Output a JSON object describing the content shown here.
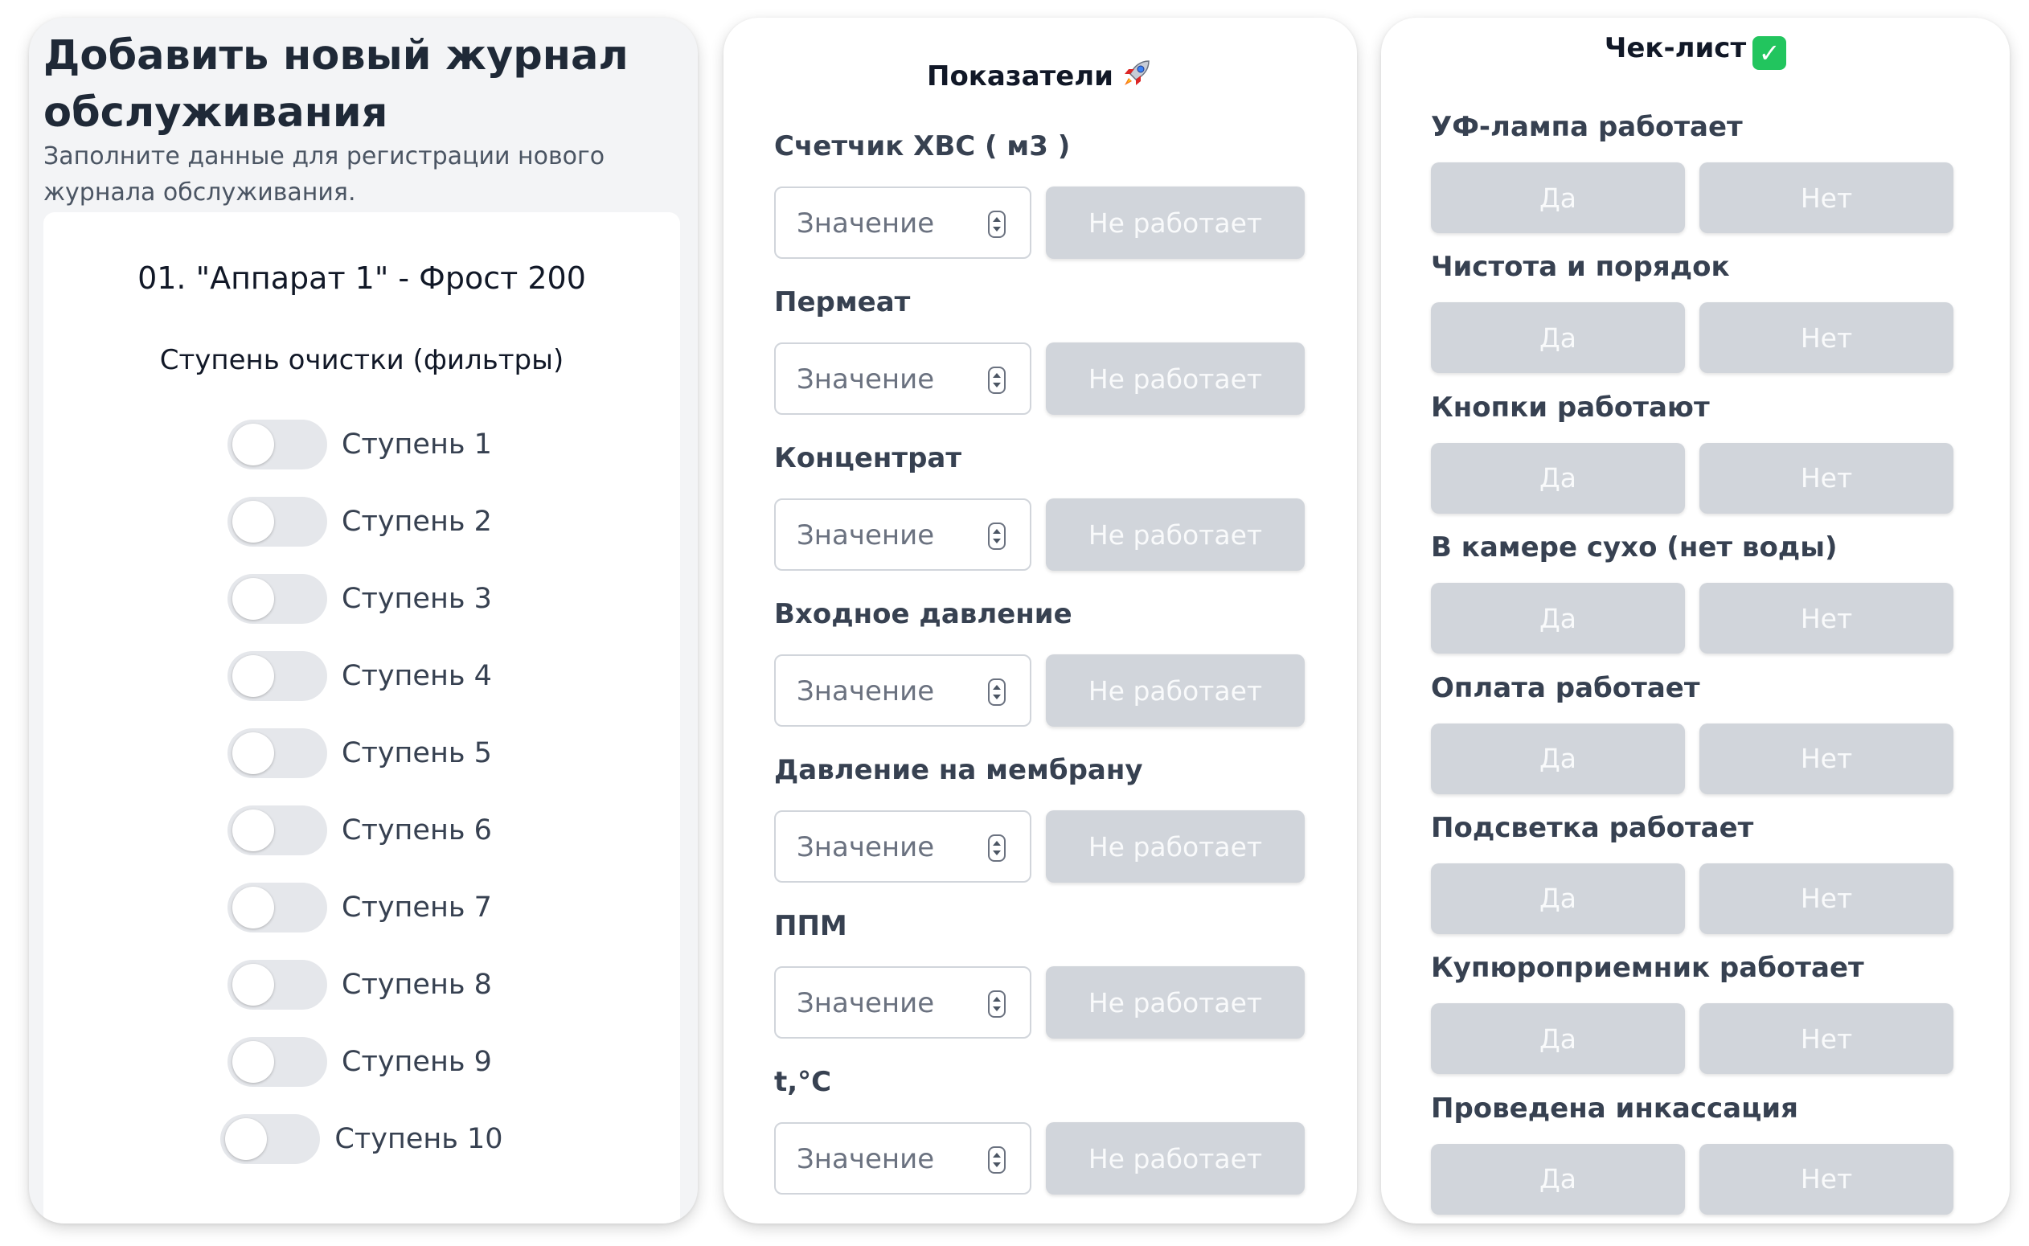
{
  "left": {
    "title": "Добавить новый журнал обслуживания",
    "subtitle": "Заполните данные для регистрации нового журнала обслуживания.",
    "device_name": "01. \"Аппарат 1\" - Фрост 200",
    "stages_heading": "Ступень очистки (фильтры)",
    "stages": [
      {
        "label": "Ступень 1",
        "on": false
      },
      {
        "label": "Ступень 2",
        "on": false
      },
      {
        "label": "Ступень 3",
        "on": false
      },
      {
        "label": "Ступень 4",
        "on": false
      },
      {
        "label": "Ступень 5",
        "on": false
      },
      {
        "label": "Ступень 6",
        "on": false
      },
      {
        "label": "Ступень 7",
        "on": false
      },
      {
        "label": "Ступень 8",
        "on": false
      },
      {
        "label": "Ступень 9",
        "on": false
      },
      {
        "label": "Ступень 10",
        "on": false
      }
    ]
  },
  "metrics_panel": {
    "title": "Показатели",
    "title_icon": "rocket-icon",
    "value_placeholder": "Значение",
    "not_working_label": "Не работает",
    "metrics": [
      {
        "label": "Счетчик ХВС ( м3 )",
        "value": ""
      },
      {
        "label": "Пермеат",
        "value": ""
      },
      {
        "label": "Концентрат",
        "value": ""
      },
      {
        "label": "Входное давление",
        "value": ""
      },
      {
        "label": "Давление на мембрану",
        "value": ""
      },
      {
        "label": "ППМ",
        "value": ""
      },
      {
        "label": "t,°C",
        "value": ""
      }
    ]
  },
  "checklist_panel": {
    "title": "Чек-лист",
    "title_icon": "check-mark-icon",
    "yes_label": "Да",
    "no_label": "Нет",
    "items": [
      {
        "label": "УФ-лампа работает"
      },
      {
        "label": "Чистота и порядок"
      },
      {
        "label": "Кнопки работают"
      },
      {
        "label": "В камере сухо (нет воды)"
      },
      {
        "label": "Оплата работает"
      },
      {
        "label": "Подсветка работает"
      },
      {
        "label": "Купюроприемник работает"
      },
      {
        "label": "Проведена инкассация"
      }
    ]
  },
  "colors": {
    "panel_bg_left": "#f3f4f6",
    "button_inactive": "#d1d5db",
    "button_text": "#f9fafb",
    "toggle_off": "#e5e7eb",
    "check_green": "#22c55e"
  }
}
